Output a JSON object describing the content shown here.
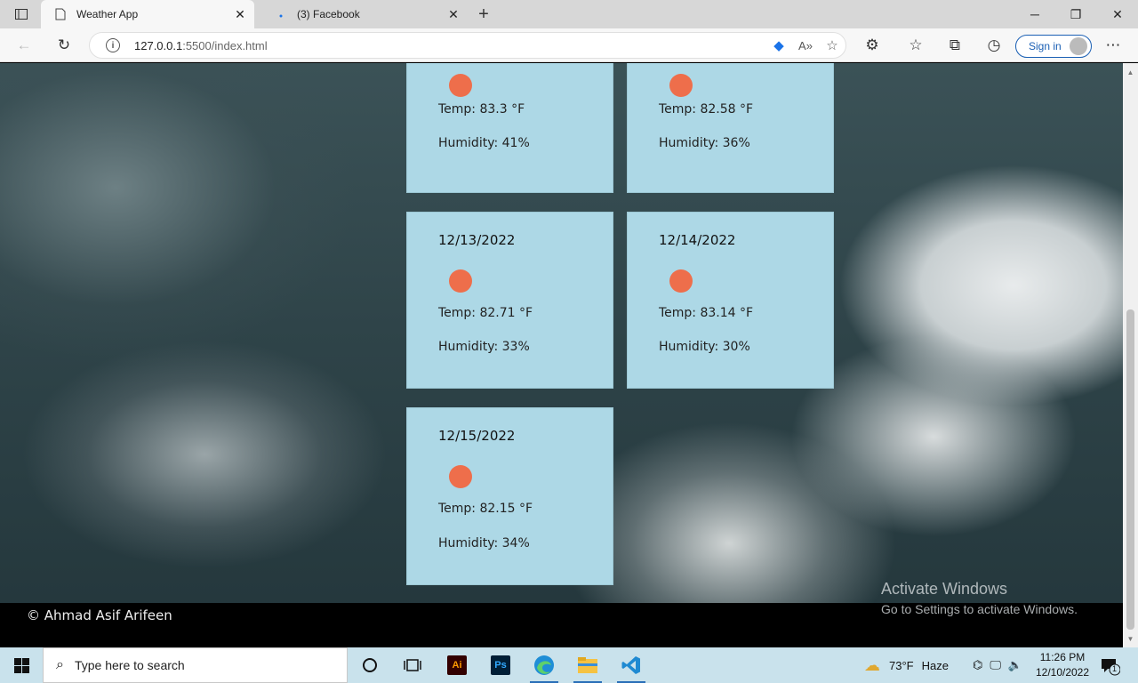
{
  "browser": {
    "tabs": [
      {
        "title": "Weather App",
        "active": true
      },
      {
        "title": "(3) Facebook",
        "active": false
      }
    ],
    "url_host": "127.0.0.1",
    "url_rest": ":5500/index.html",
    "signin_label": "Sign in"
  },
  "page": {
    "cards": [
      {
        "date": "",
        "temp": "Temp: 83.3 °F",
        "humidity": "Humidity: 41%"
      },
      {
        "date": "",
        "temp": "Temp: 82.58 °F",
        "humidity": "Humidity: 36%"
      },
      {
        "date": "12/13/2022",
        "temp": "Temp: 82.71 °F",
        "humidity": "Humidity: 33%"
      },
      {
        "date": "12/14/2022",
        "temp": "Temp: 83.14 °F",
        "humidity": "Humidity: 30%"
      },
      {
        "date": "12/15/2022",
        "temp": "Temp: 82.15 °F",
        "humidity": "Humidity: 34%"
      }
    ],
    "footer": "© Ahmad Asif Arifeen",
    "sun_color": "#ee6e4b",
    "card_color": "#add8e6"
  },
  "watermark": {
    "line1": "Activate Windows",
    "line2": "Go to Settings to activate Windows."
  },
  "taskbar": {
    "search_placeholder": "Type here to search",
    "weather": "73°F",
    "weather_desc": "Haze",
    "time": "11:26 PM",
    "date": "12/10/2022",
    "notification_count": "1",
    "apps": [
      "cortana-icon",
      "task-view-icon",
      "illustrator-icon",
      "photoshop-icon",
      "edge-icon",
      "file-explorer-icon",
      "vscode-icon"
    ]
  }
}
